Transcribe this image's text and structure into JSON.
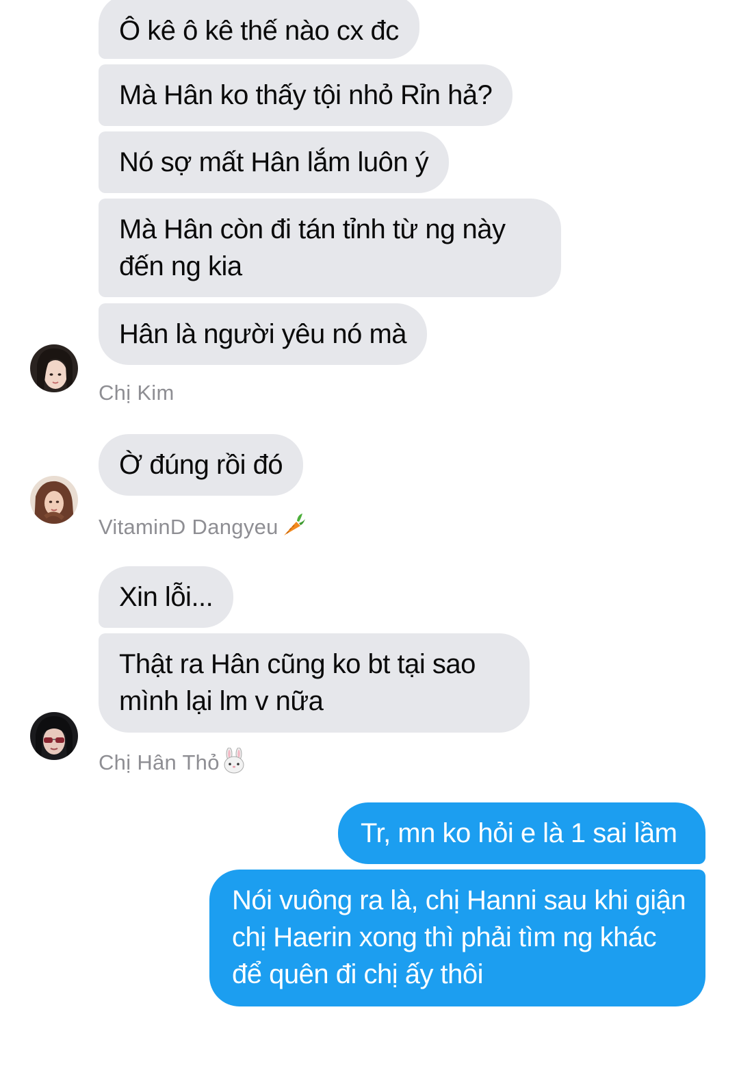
{
  "conversation": {
    "group1": {
      "messages": [
        "Ô kê ô kê thế nào cx đc",
        "Mà Hân ko thấy tội nhỏ Rỉn hả?",
        "Nó sợ mất Hân lắm luôn ý",
        "Mà Hân còn đi tán tỉnh từ ng này đến ng kia",
        "Hân là người yêu nó mà"
      ],
      "sender": "Chị Kim"
    },
    "group2": {
      "messages": [
        "Ờ đúng rồi đó"
      ],
      "sender": "VitaminD Dangyeu",
      "sender_emoji": "carrot-emoji"
    },
    "group3": {
      "messages": [
        "Xin lỗi...",
        "Thật ra Hân cũng ko bt tại sao mình lại lm v nữa"
      ],
      "sender": "Chị Hân Thỏ",
      "sender_emoji": "rabbit-emoji"
    },
    "outgoing": {
      "messages": [
        "Tr, mn ko hỏi e là 1 sai lầm",
        "Nói vuông ra là, chị Hanni sau khi giận chị Haerin xong thì phải tìm ng khác để quên đi chị ấy thôi"
      ]
    }
  },
  "colors": {
    "incoming_bubble": "#e6e7eb",
    "outgoing_bubble": "#1c9ef0",
    "sender_name": "#8e8e93"
  }
}
